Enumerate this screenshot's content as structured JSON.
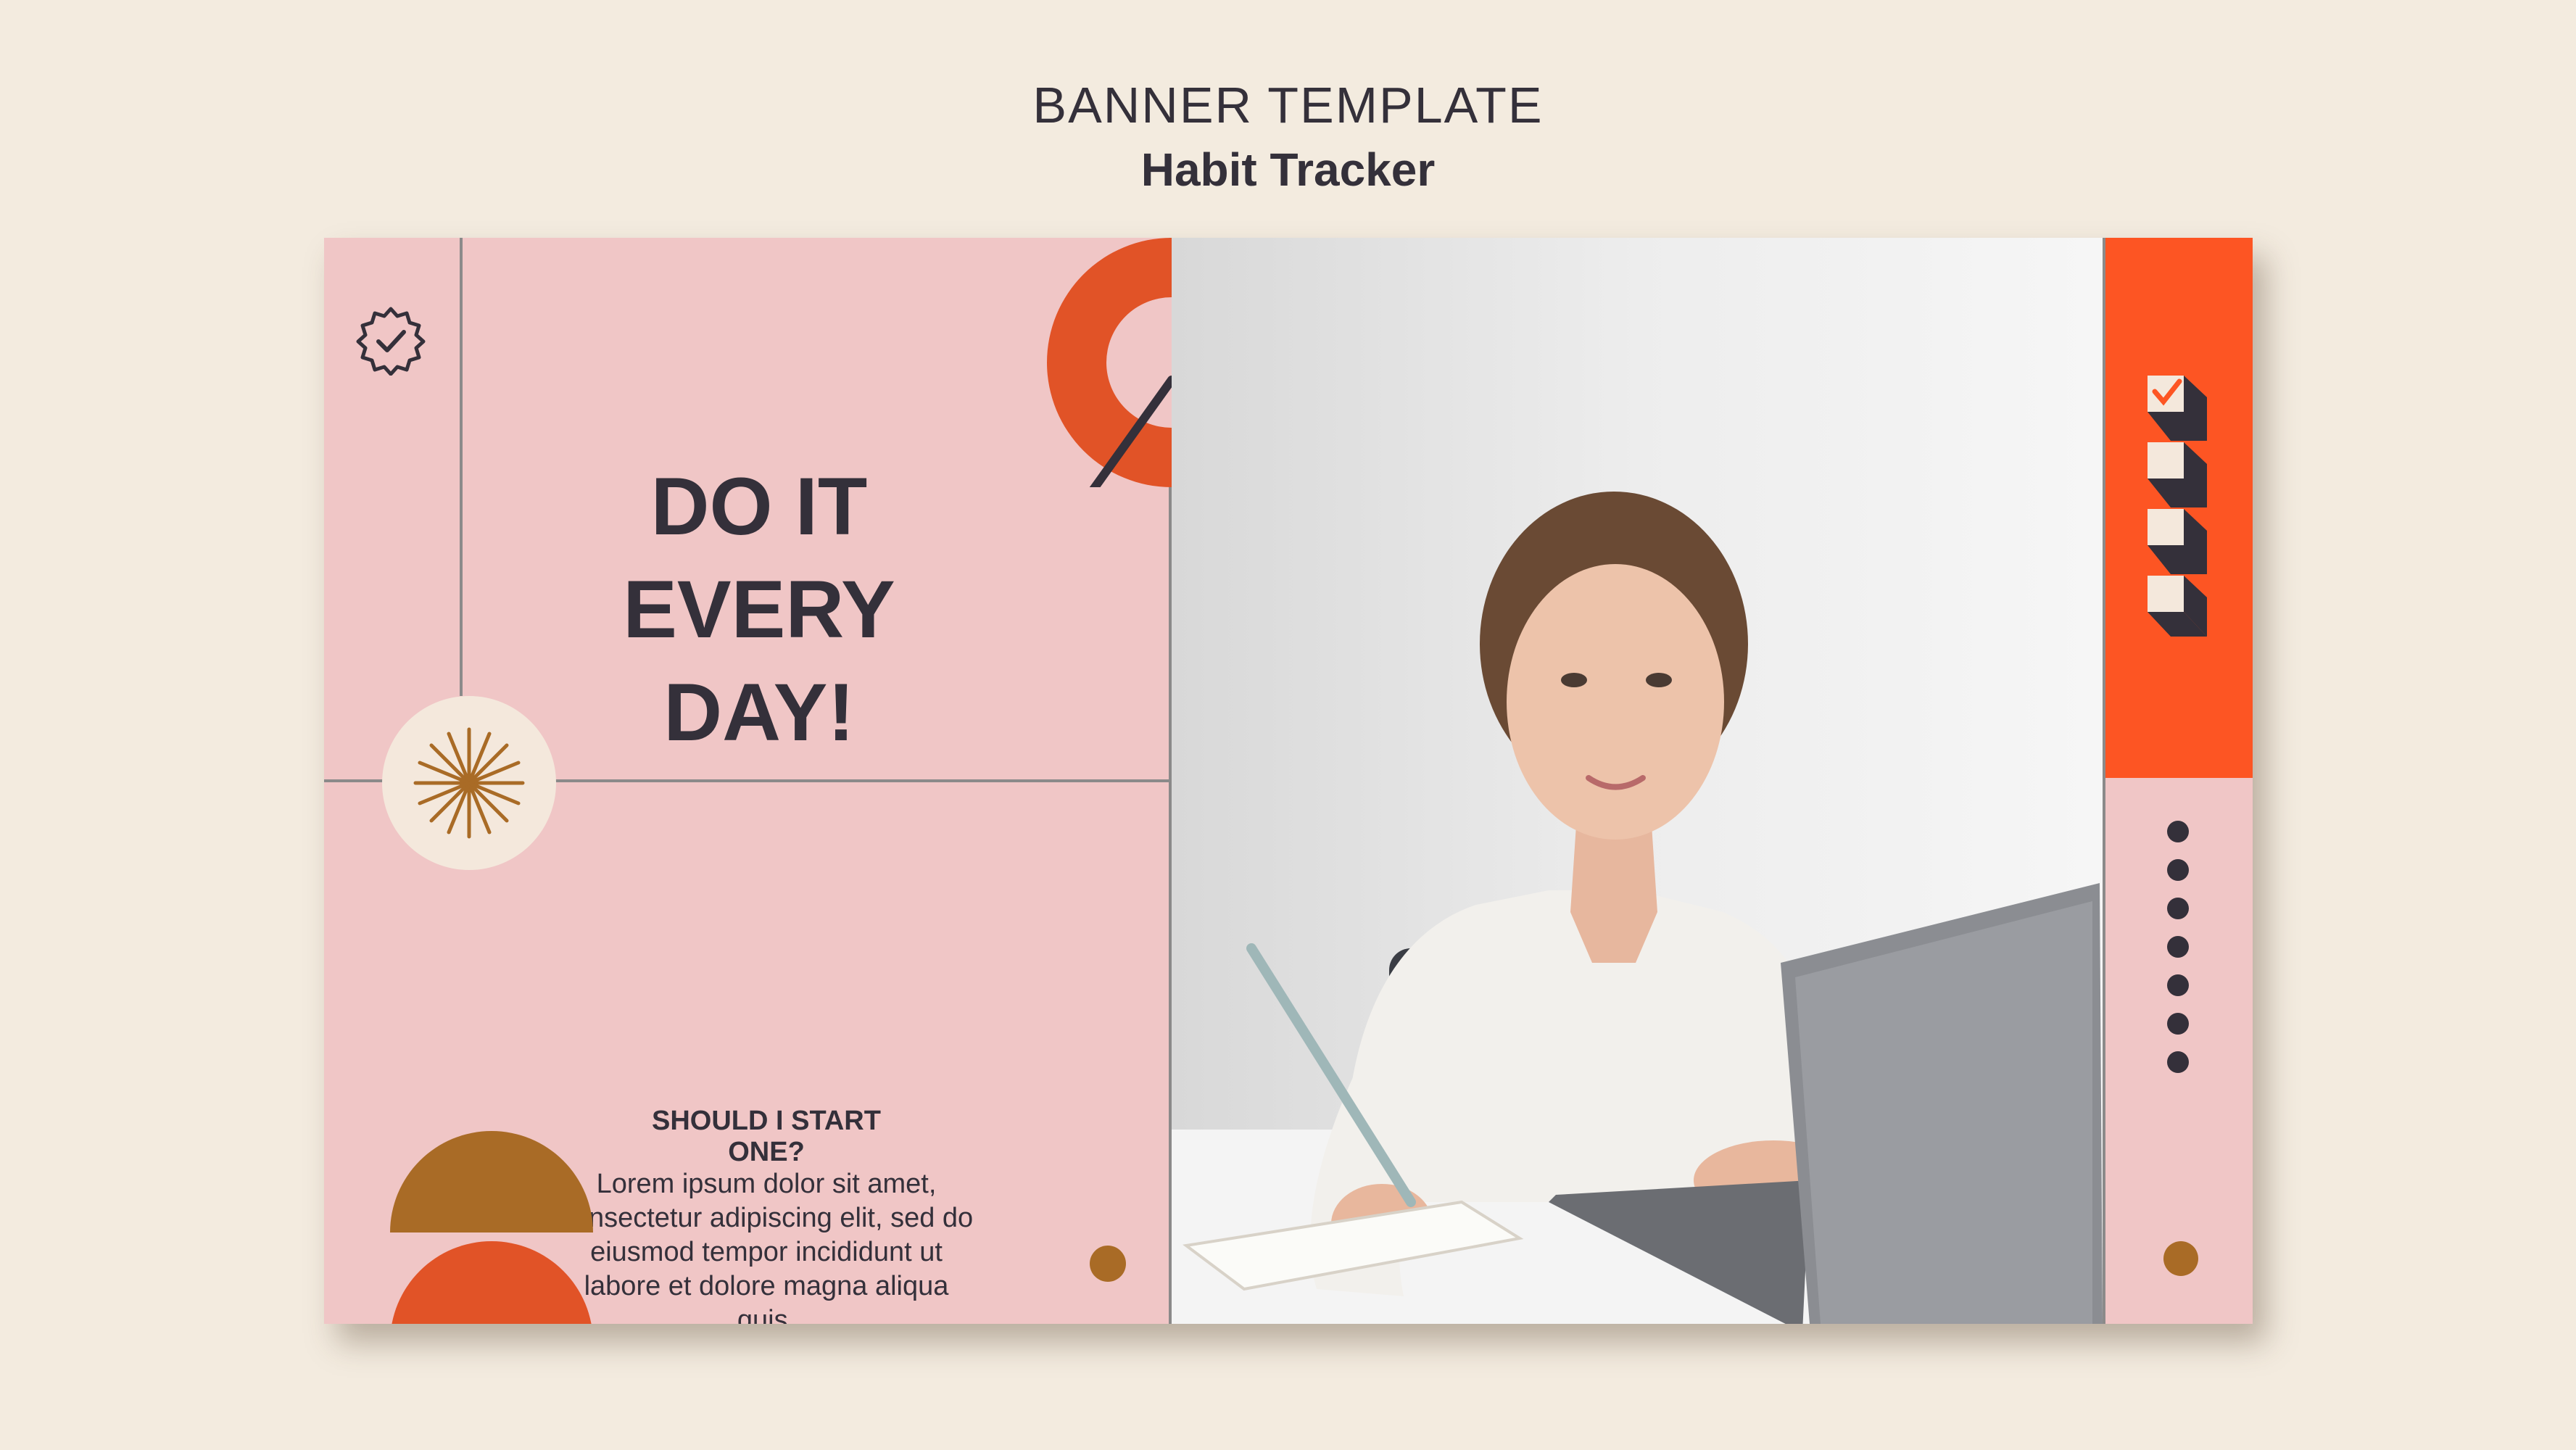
{
  "header": {
    "title": "BANNER TEMPLATE",
    "subtitle": "Habit Tracker"
  },
  "banner": {
    "headline_line1": "DO IT",
    "headline_line2": "EVERY DAY!",
    "subheading": "SHOULD I START ONE?",
    "body_lines": [
      "Lorem ipsum dolor sit amet,",
      "consectetur adipiscing elit, sed do",
      "eiusmod tempor incididunt ut",
      "labore et dolore magna aliqua quis."
    ]
  },
  "icons": {
    "badge": "verified-badge-icon",
    "burst": "starburst-icon",
    "checklist": "checklist-icon"
  },
  "colors": {
    "background": "#f3ebdf",
    "pink": "#f0c6c6",
    "orange": "#fd5523",
    "rust": "#e15327",
    "brown": "#a96b26",
    "dark": "#34303a",
    "cream": "#f4e8dc"
  },
  "sidebar": {
    "dot_count": 7
  }
}
